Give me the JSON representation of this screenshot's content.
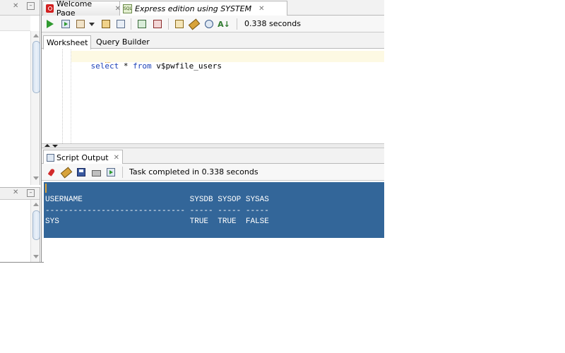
{
  "tabs": [
    {
      "label": "Welcome Page",
      "icon": "oracle-icon",
      "active": false
    },
    {
      "label": "Express edition using SYSTEM",
      "icon": "sql-connection-icon",
      "active": true
    }
  ],
  "toolbar": {
    "time_label": "0.338 seconds"
  },
  "worksheet_tabs": [
    {
      "label": "Worksheet",
      "active": true
    },
    {
      "label": "Query Builder",
      "active": false
    }
  ],
  "editor": {
    "kw1": "select",
    "star": " * ",
    "kw2": "from",
    "rest": " v$pwfile_users"
  },
  "script_output": {
    "tab_label": "Script Output",
    "status": "Task completed in 0.338 seconds",
    "lines": [
      "USERNAME                       SYSDB SYSOP SYSAS",
      "------------------------------ ----- ----- -----",
      "SYS                            TRUE  TRUE  FALSE"
    ]
  },
  "colors": {
    "result_bg": "#336699",
    "keyword": "#1f43b8",
    "accent_orange": "#f0c040"
  }
}
